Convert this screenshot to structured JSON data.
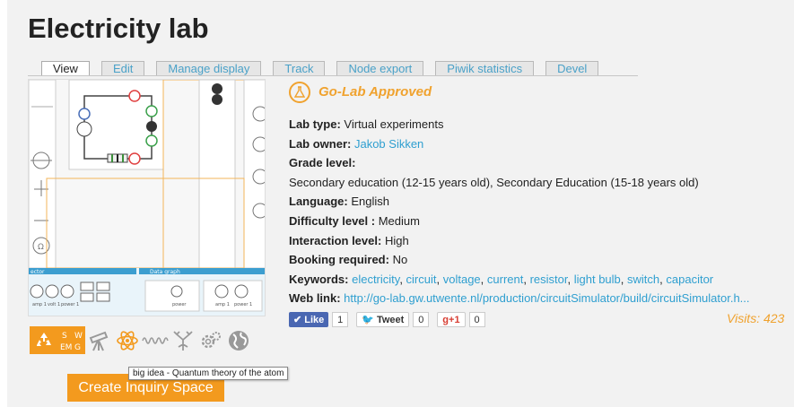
{
  "page": {
    "title": "Electricity lab"
  },
  "tabs": [
    {
      "label": "View",
      "active": true
    },
    {
      "label": "Edit"
    },
    {
      "label": "Manage display"
    },
    {
      "label": "Track"
    },
    {
      "label": "Node export"
    },
    {
      "label": "Piwik statistics"
    },
    {
      "label": "Devel"
    }
  ],
  "badge": {
    "label": "Go-Lab Approved",
    "icon": "flask-icon"
  },
  "details": {
    "lab_type_label": "Lab type:",
    "lab_type": "Virtual experiments",
    "lab_owner_label": "Lab owner:",
    "lab_owner": "Jakob Sikken",
    "grade_label": "Grade level:",
    "grade_value": "Secondary education (12-15 years old), Secondary Education (15-18 years old)",
    "language_label": "Language:",
    "language": "English",
    "difficulty_label": "Difficulty level :",
    "difficulty": "Medium",
    "interaction_label": "Interaction level:",
    "interaction": "High",
    "booking_label": "Booking required:",
    "booking": "No",
    "keywords_label": "Keywords:",
    "keywords": [
      "electricity",
      "circuit",
      "voltage",
      "current",
      "resistor",
      "light bulb",
      "switch",
      "capacitor"
    ],
    "weblink_label": "Web link:",
    "weblink": "http://go-lab.gw.utwente.nl/production/circuitSimulator/build/circuitSimulator.h..."
  },
  "social": {
    "like_label": "Like",
    "like_count": "1",
    "tweet_label": "Tweet",
    "tweet_count": "0",
    "gplus_label": "g+1",
    "gplus_count": "0"
  },
  "visits": "Visits: 423",
  "screenshot": {
    "panel_labels": [
      "ector",
      "Data graph"
    ],
    "meter_labels": [
      "amp 1",
      "volt 1",
      "power 1",
      "power",
      "amp 1",
      "power 1"
    ]
  },
  "big_ideas": {
    "icons": [
      "recycle-icon",
      "sem-icon",
      "telescope-icon",
      "atom-icon",
      "wave-icon",
      "tree-icon",
      "gears-icon",
      "globe-icon"
    ],
    "sem_letters": [
      "S",
      "W",
      "EM",
      "G"
    ]
  },
  "tooltip": "big idea - Quantum theory of the atom",
  "cta": {
    "label": "Create Inquiry Space"
  },
  "colors": {
    "accent": "#f39a1e",
    "link": "#2f9fd0"
  }
}
